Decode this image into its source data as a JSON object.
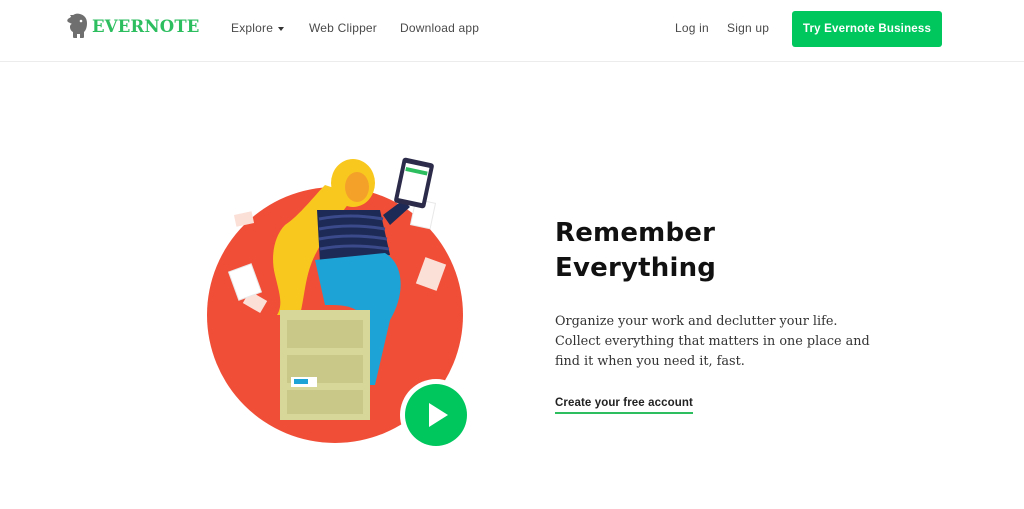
{
  "brand": {
    "name": "EVERNOTE",
    "logo_icon": "elephant-icon",
    "color": "#2dbe60"
  },
  "nav": {
    "explore": "Explore",
    "web_clipper": "Web Clipper",
    "download_app": "Download app",
    "log_in": "Log in",
    "sign_up": "Sign up",
    "try_business": "Try Evernote Business"
  },
  "hero": {
    "title_line1": "Remember",
    "title_line2": "Everything",
    "desc_lines": [
      "Organize your work and declutter your life.",
      "Collect everything that matters in one place and",
      "find it when you need it, fast."
    ],
    "cta": "Create your free account",
    "illustration": "woman-on-file-cabinet-illustration",
    "play_icon": "play-icon"
  },
  "colors": {
    "accent": "#00c65e",
    "circle": "#f04e37",
    "hair": "#f9c81e",
    "pants": "#1ea3d6"
  }
}
